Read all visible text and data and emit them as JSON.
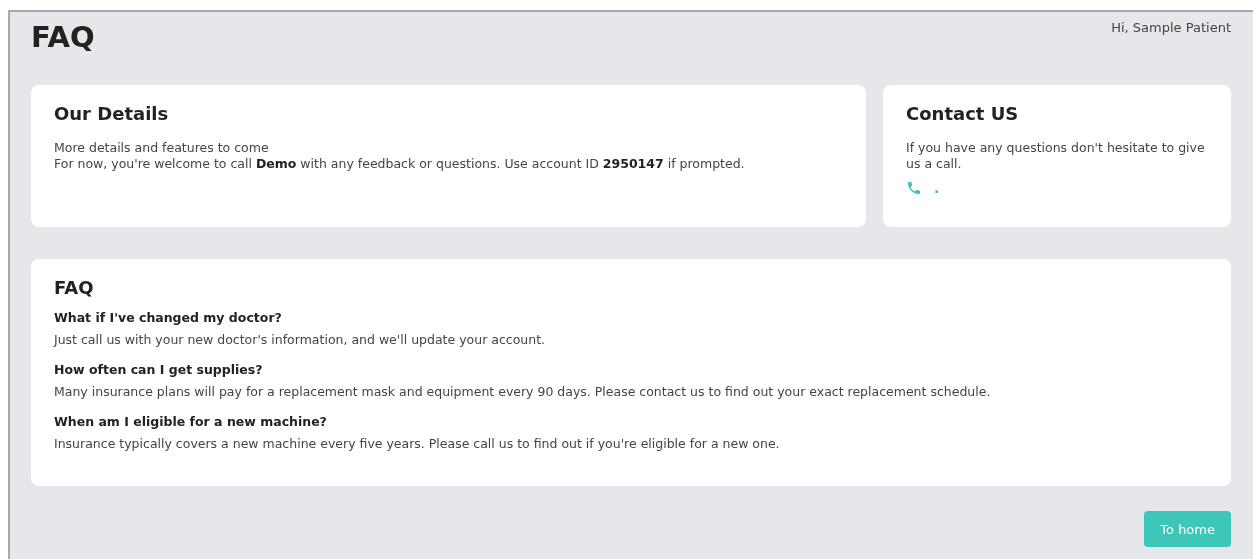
{
  "page": {
    "title": "FAQ",
    "greeting": "Hi, Sample Patient"
  },
  "details": {
    "title": "Our Details",
    "lines": [
      "More details and features to come",
      "For now, you're welcome to call **Demo** with any feedback or questions. Use account ID **2950147** if prompted."
    ]
  },
  "contact": {
    "title": "Contact US",
    "text": "If you have any questions don't hesitate to give us a call.",
    "phone": "."
  },
  "faq": {
    "title": "FAQ",
    "items": [
      {
        "question": "What if I've changed my doctor?",
        "answer": "Just call us with your new doctor's information, and we'll update your account."
      },
      {
        "question": "How often can I get supplies?",
        "answer": "Many insurance plans will pay for a replacement mask and equipment every 90 days. Please contact us to find out your exact replacement schedule."
      },
      {
        "question": "When am I eligible for a new machine?",
        "answer": "Insurance typically covers a new machine every five years. Please call us to find out if you're eligible for a new one."
      }
    ]
  },
  "button": {
    "label": "To home"
  }
}
